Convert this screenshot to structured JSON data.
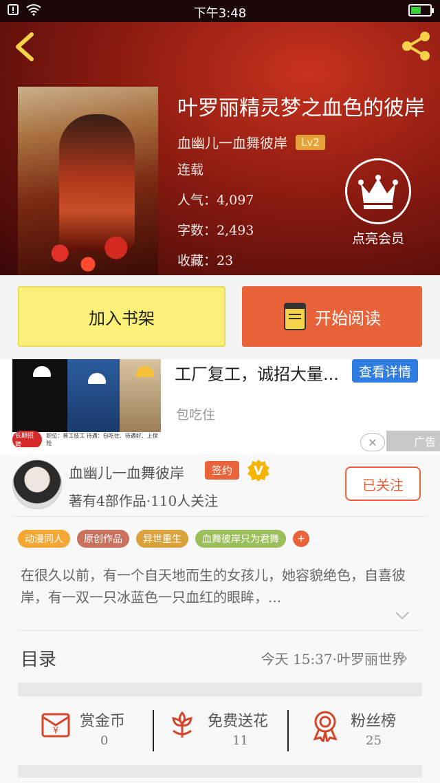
{
  "status_bar": {
    "time": "下午3:48"
  },
  "book": {
    "title": "叶罗丽精灵梦之血色的彼岸",
    "author": "血幽儿一血舞彼岸",
    "level": "Lv2",
    "status": "连载",
    "popularity": "人气：4,097",
    "word_count": "字数：2,493",
    "favorites": "收藏：23",
    "vip_label": "点亮会员"
  },
  "actions": {
    "add_shelf": "加入书架",
    "start_reading": "开始阅读"
  },
  "ad": {
    "title": "工厂复工，诚招大量...",
    "button": "查看详情",
    "subtitle": "包吃住",
    "label": "广告",
    "image_tag": "长期招聘",
    "image_text": "职位：普工技工  待遇：包吃住、待遇好、上保险",
    "close": "✕"
  },
  "author_card": {
    "name": "血幽儿一血舞彼岸",
    "sign_badge": "签约",
    "v_badge": "V",
    "stats": "著有4部作品·110人关注",
    "follow_button": "已关注",
    "tags": [
      {
        "label": "动漫同人",
        "color": "#f4a733"
      },
      {
        "label": "原创作品",
        "color": "#c9725d"
      },
      {
        "label": "异世重生",
        "color": "#d9a23a"
      },
      {
        "label": "血舞彼岸只为君舞",
        "color": "#9bbf5a"
      }
    ],
    "tag_more": "+",
    "description": "在很久以前，有一个自天地而生的女孩儿，她容貌绝色，自喜彼岸，有一双一只冰蓝色一只血红的眼眸，..."
  },
  "toc": {
    "label": "目录",
    "latest": "今天 15:37·叶罗丽世界"
  },
  "stats": [
    {
      "label": "赏金币",
      "value": "0"
    },
    {
      "label": "免费送花",
      "value": "11"
    },
    {
      "label": "粉丝榜",
      "value": "25"
    }
  ],
  "colors": {
    "accent": "#e8623a",
    "yellow_button": "#fbf078",
    "ad_button": "#2f7de1"
  }
}
